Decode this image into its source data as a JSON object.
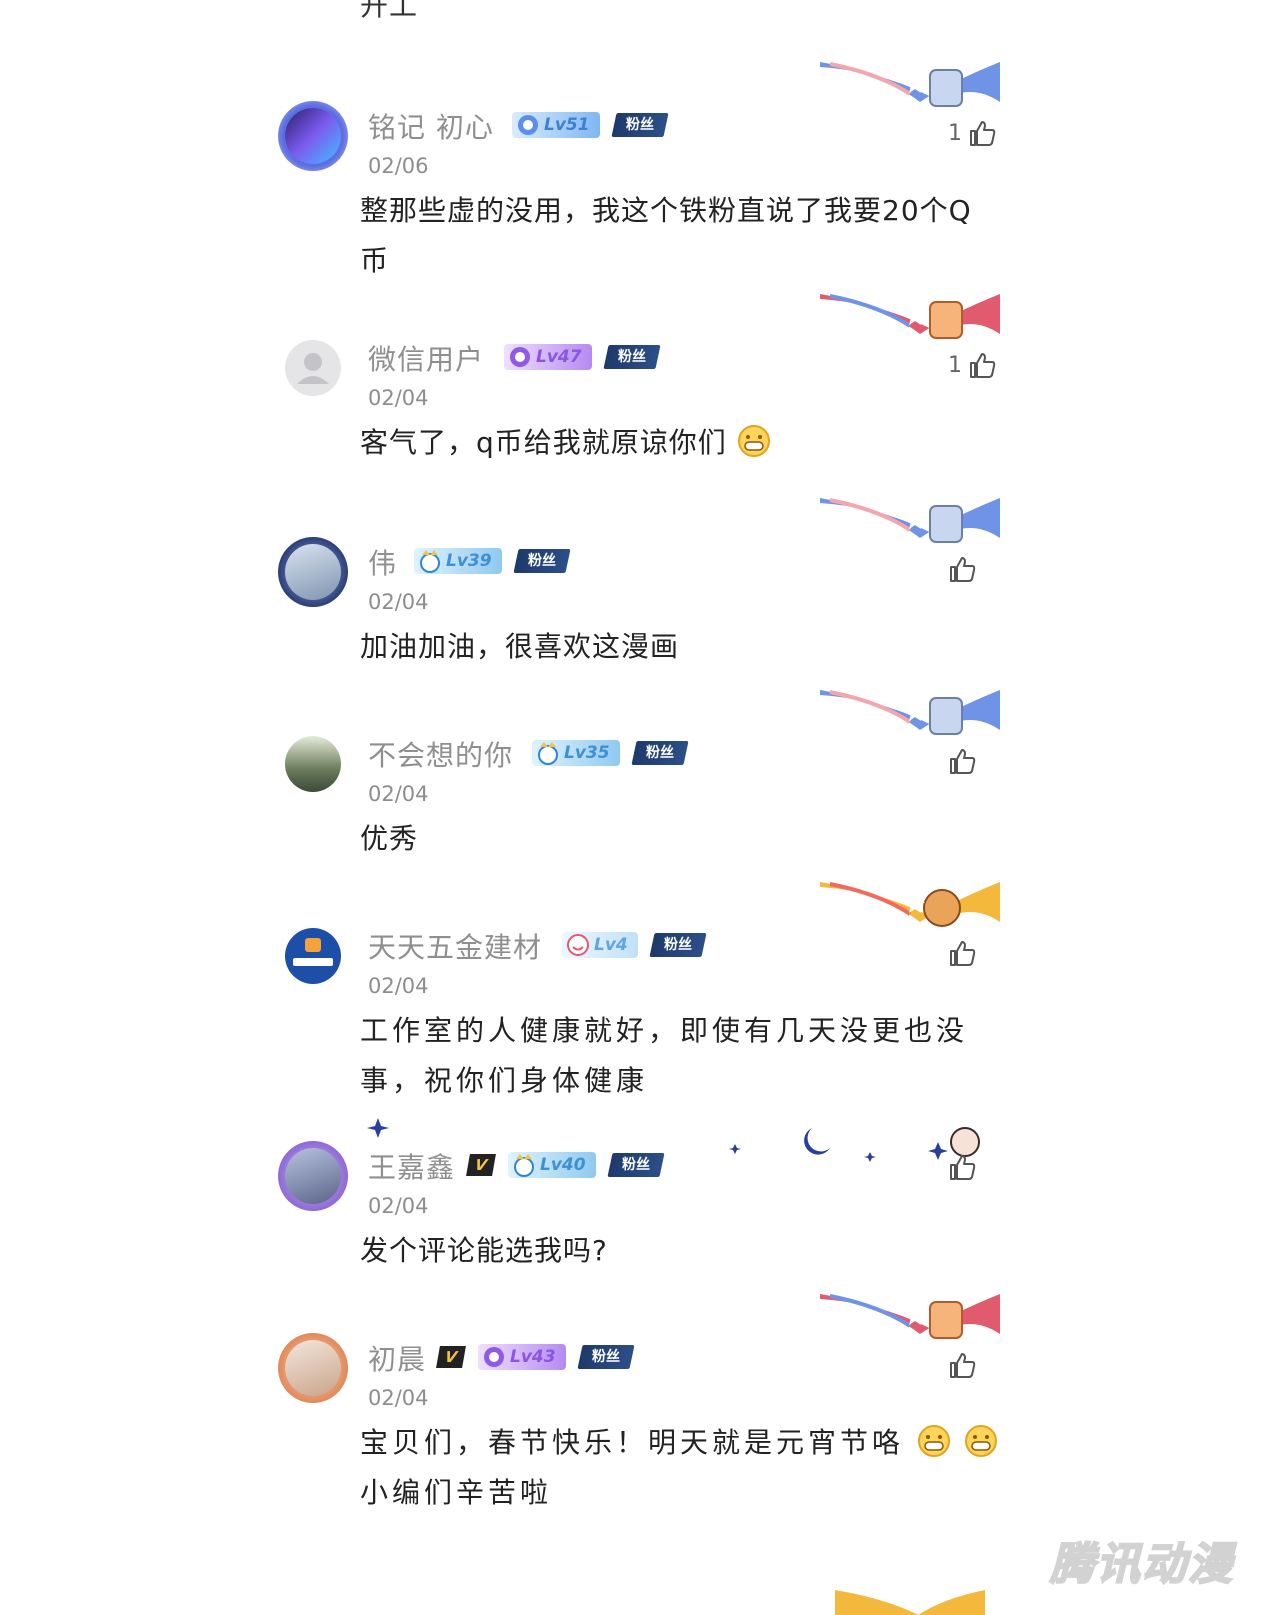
{
  "top_text": "开工",
  "comments": [
    {
      "name": "铭记 初心",
      "level": "Lv51",
      "fan": "粉丝",
      "date": "02/06",
      "text": "整那些虚的没用，我这个铁粉直说了我要20个Q币",
      "likes": "1"
    },
    {
      "name": "微信用户",
      "level": "Lv47",
      "fan": "粉丝",
      "date": "02/04",
      "text": "客气了，q币给我就原谅你们",
      "likes": "1"
    },
    {
      "name": "伟",
      "level": "Lv39",
      "fan": "粉丝",
      "date": "02/04",
      "text": "加油加油，很喜欢这漫画",
      "likes": ""
    },
    {
      "name": "不会想的你",
      "level": "Lv35",
      "fan": "粉丝",
      "date": "02/04",
      "text": "优秀",
      "likes": ""
    },
    {
      "name": "天天五金建材",
      "level": "Lv4",
      "fan": "粉丝",
      "date": "02/04",
      "text": "工作室的人健康就好，即使有几天没更也没事，祝你们身体健康",
      "likes": ""
    },
    {
      "name": "王嘉鑫",
      "vip": "V",
      "level": "Lv40",
      "fan": "粉丝",
      "date": "02/04",
      "text": "发个评论能选我吗?",
      "likes": ""
    },
    {
      "name": "初晨",
      "vip": "V",
      "level": "Lv43",
      "fan": "粉丝",
      "date": "02/04",
      "text": "宝贝们，春节快乐！明天就是元宵节咯",
      "text2": "小编们辛苦啦",
      "likes": ""
    }
  ],
  "watermark": "腾讯动漫",
  "colors": {
    "name": "#8f8f8f",
    "date": "#8d8d8d",
    "fan_badge": "#1e3a6b",
    "text": "#222222"
  },
  "icons": {
    "like": "thumbs-up-icon",
    "emoji": "grin-emoji-icon"
  }
}
